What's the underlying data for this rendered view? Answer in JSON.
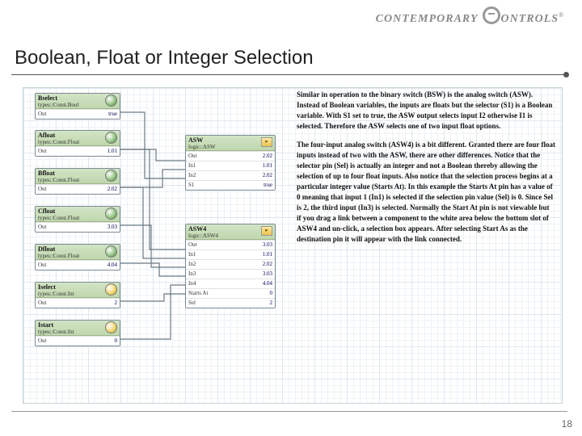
{
  "brand": "CONTEMPORARY C ONTROLS",
  "title": "Boolean, Float or Integer Selection",
  "page_number": "18",
  "blocks": {
    "bselect": {
      "name": "Bselect",
      "type": "types::Const.Bool",
      "rows": [
        [
          "Out",
          "true"
        ]
      ]
    },
    "afloat": {
      "name": "Afloat",
      "type": "types::Const.Float",
      "rows": [
        [
          "Out",
          "1.01"
        ]
      ]
    },
    "bfloat": {
      "name": "Bfloat",
      "type": "types::Const.Float",
      "rows": [
        [
          "Out",
          "2.02"
        ]
      ]
    },
    "cfloat": {
      "name": "Cfloat",
      "type": "types::Const.Float",
      "rows": [
        [
          "Out",
          "3.03"
        ]
      ]
    },
    "dfloat": {
      "name": "Dfloat",
      "type": "types::Const.Float",
      "rows": [
        [
          "Out",
          "4.04"
        ]
      ]
    },
    "iselect": {
      "name": "Iselect",
      "type": "types::Const.Int",
      "rows": [
        [
          "Out",
          "2"
        ]
      ]
    },
    "istart": {
      "name": "Istart",
      "type": "types::Const.Int",
      "rows": [
        [
          "Out",
          "0"
        ]
      ]
    },
    "asw": {
      "name": "ASW",
      "type": "logic::ASW",
      "rows": [
        [
          "Out",
          "2.02"
        ],
        [
          "In1",
          "1.01"
        ],
        [
          "In2",
          "2.02"
        ],
        [
          "S1",
          "true"
        ]
      ]
    },
    "asw4": {
      "name": "ASW4",
      "type": "logic::ASW4",
      "rows": [
        [
          "Out",
          "3.03"
        ],
        [
          "In1",
          "1.01"
        ],
        [
          "In2",
          "2.02"
        ],
        [
          "In3",
          "3.03"
        ],
        [
          "In4",
          "4.04"
        ],
        [
          "Starts At",
          "0"
        ],
        [
          "Sel",
          "2"
        ]
      ]
    }
  },
  "paragraphs": [
    "Similar in operation to the binary switch (BSW) is the analog switch (ASW).  Instead of Boolean variables, the inputs are floats but the selector (S1) is a Boolean variable.  With S1 set to true, the ASW output selects input I2 otherwise I1 is selected.  Therefore the ASW selects one of two input float options.",
    "The four-input analog switch (ASW4) is a bit different.  Granted there are four float inputs instead of two with the ASW, there are other differences.  Notice that the selector pin (Sel) is actually an integer and not a Boolean thereby allowing the selection of up to four float inputs.  Also notice that the selection process begins at a particular integer value (Starts At).  In this example the Starts At pin has a value of 0 meaning that input 1 (In1) is selected if the selection pin value (Sel) is 0.  Since Sel is 2, the third input (In3) is selected.  Normally the Start At pin is not viewable but if you drag a link between a component to the white area below the bottom slot of ASW4 and un-click,  a selection box appears.  After selecting Start As as the destination pin it will appear with the link connected."
  ]
}
